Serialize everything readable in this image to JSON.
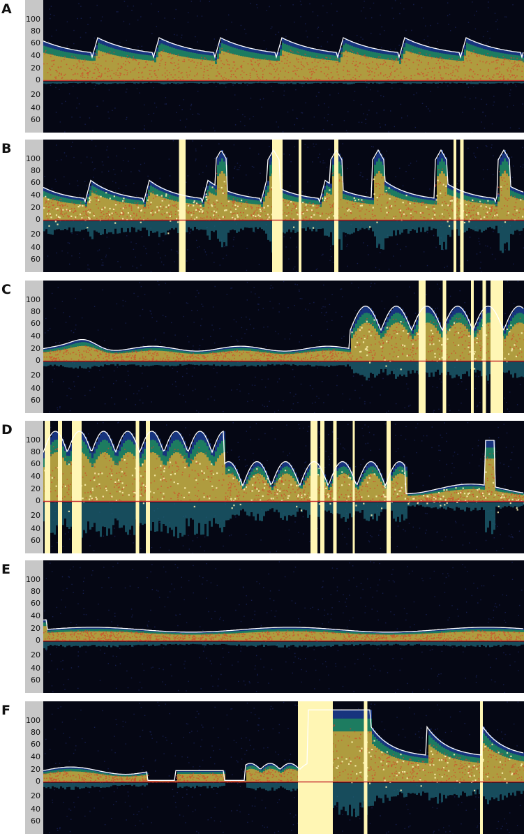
{
  "panels": [
    {
      "label": "A",
      "ticks": [
        "100",
        "80",
        "60",
        "40",
        "20",
        "0",
        "20",
        "40",
        "60"
      ]
    },
    {
      "label": "B",
      "ticks": [
        "100",
        "80",
        "60",
        "40",
        "20",
        "0",
        "20",
        "40",
        "60"
      ]
    },
    {
      "label": "C",
      "ticks": [
        "100",
        "80",
        "60",
        "40",
        "20",
        "0",
        "20",
        "40",
        "60"
      ]
    },
    {
      "label": "D",
      "ticks": [
        "100",
        "80",
        "60",
        "40",
        "20",
        "0",
        "20",
        "40",
        "60"
      ]
    },
    {
      "label": "E",
      "ticks": [
        "100",
        "80",
        "60",
        "40",
        "20",
        "0",
        "20",
        "40",
        "60"
      ]
    },
    {
      "label": "F",
      "ticks": [
        "100",
        "80",
        "60",
        "40",
        "20",
        "0",
        "20",
        "40",
        "60"
      ]
    }
  ],
  "colors": {
    "background": "#050714",
    "baseline": "#c83232",
    "envelope": "#ffffff",
    "saturation": "#fff6b4",
    "gutter": "#c7c7c7"
  }
}
